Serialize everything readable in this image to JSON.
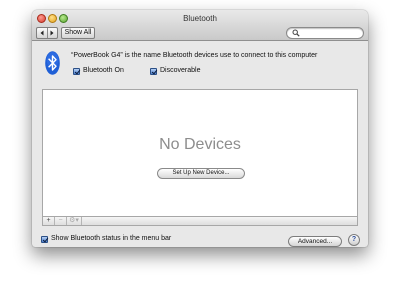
{
  "window": {
    "title": "Bluetooth"
  },
  "toolbar": {
    "show_all_label": "Show All",
    "back_icon": "chevron-left-icon",
    "forward_icon": "chevron-right-icon",
    "search": {
      "value": "",
      "icon": "search-icon"
    }
  },
  "bluetooth": {
    "device_name_line": "“PowerBook G4” is the name Bluetooth devices use to connect to this computer",
    "bluetooth_on": {
      "label": "Bluetooth On",
      "checked": true
    },
    "discoverable": {
      "label": "Discoverable",
      "checked": true
    }
  },
  "devices": {
    "empty_message": "No Devices",
    "setup_button_label": "Set Up New Device...",
    "list_controls": {
      "add": "+",
      "remove": "−",
      "action": "⚙▾"
    }
  },
  "footer": {
    "menu_bar_status": {
      "label": "Show Bluetooth status in the menu bar",
      "checked": true
    },
    "advanced_label": "Advanced...",
    "help_label": "?"
  },
  "colors": {
    "bluetooth_blue": "#1f5fd6",
    "checkbox_blue": "#4b7fcf",
    "empty_text_gray": "#8d8d8d"
  }
}
